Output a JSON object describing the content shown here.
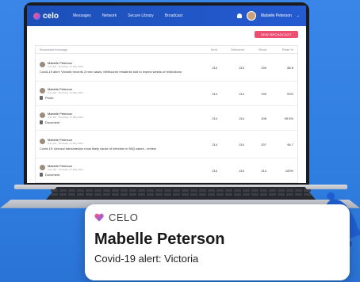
{
  "colors": {
    "background": "#2f7fe0",
    "nav": "#1c4fb7",
    "accent": "#ec4f72",
    "bell": "#1f5fd0"
  },
  "app": {
    "logo": "celo"
  },
  "nav": {
    "items": [
      "Messages",
      "Network",
      "Secure Library",
      "Broadcast"
    ],
    "user": "Mabelle Peterson"
  },
  "toolbar": {
    "new_broadcast": "NEW BROADCAST"
  },
  "table": {
    "columns": [
      "Broadcast message",
      "Sent",
      "Delivered",
      "Read",
      "Read %"
    ],
    "rows": [
      {
        "sender": "Mabelle Peterson",
        "date": "4:21 AM · Thursday, 27 May 2021",
        "text": "Covid-19 alert: Victoria records 3 new cases; Melbourne residents told to expect weeks of restrictions",
        "attachment": "",
        "sent": "214",
        "delivered": "214",
        "read": "190",
        "percent": "88.8"
      },
      {
        "sender": "Mabelle Peterson",
        "date": "4:21 AM · Thursday, 27 May 2021",
        "text": "",
        "attachment": "Photo",
        "sent": "214",
        "delivered": "214",
        "read": "199",
        "percent": "93%"
      },
      {
        "sender": "Mabelle Peterson",
        "date": "4:21 AM · Thursday, 27 May 2021",
        "text": "",
        "attachment": "Document",
        "sent": "214",
        "delivered": "214",
        "read": "208",
        "percent": "95.5%"
      },
      {
        "sender": "Mabelle Peterson",
        "date": "4:21 AM · Thursday, 27 May 2021",
        "text": "Covid-19: Aerosol transmission most likely cause of infection in MIQ cases - review",
        "attachment": "",
        "sent": "214",
        "delivered": "214",
        "read": "207",
        "percent": "96.7"
      },
      {
        "sender": "Mabelle Peterson",
        "date": "4:21 AM · Thursday, 27 May 2021",
        "text": "",
        "attachment": "Document",
        "sent": "214",
        "delivered": "214",
        "read": "214",
        "percent": "100%"
      }
    ]
  },
  "notification": {
    "app_name": "CELO",
    "title": "Mabelle Peterson",
    "body": "Covid-19 alert: Victoria"
  }
}
